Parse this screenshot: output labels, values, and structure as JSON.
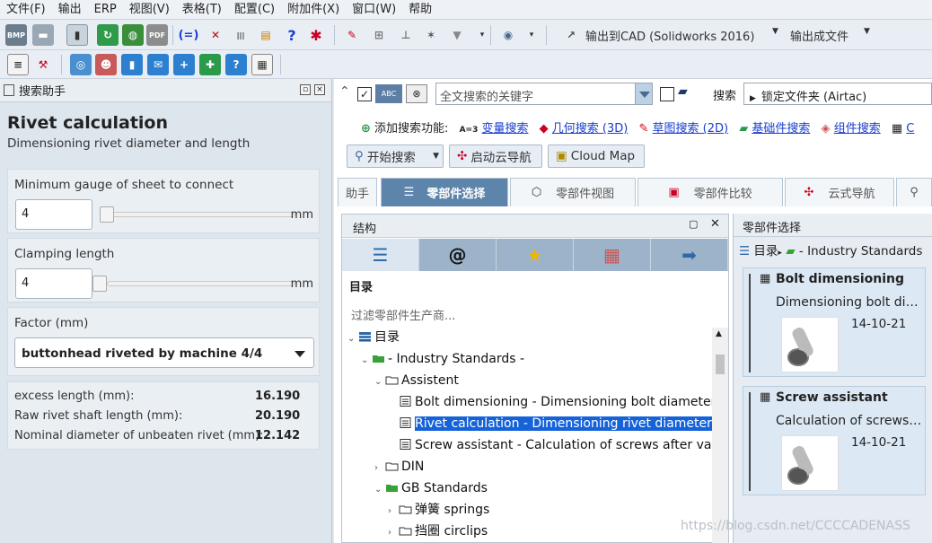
{
  "menu": [
    "文件(F)",
    "输出",
    "ERP",
    "视图(V)",
    "表格(T)",
    "配置(C)",
    "附加件(X)",
    "窗口(W)",
    "帮助"
  ],
  "toolbar": {
    "export_cad": "输出到CAD (Solidworks 2016)",
    "export_file": "输出成文件",
    "bmp_label": "BMP"
  },
  "left_panel": {
    "title": "搜索助手",
    "heading": "Rivet calculation",
    "subheading": "Dimensioning rivet diameter and length",
    "min_gauge": {
      "label": "Minimum gauge of sheet to connect",
      "value": "4",
      "unit": "mm"
    },
    "clamping": {
      "label": "Clamping length",
      "value": "4",
      "unit": "mm"
    },
    "factor": {
      "label": "Factor (mm)",
      "value": "buttonhead riveted by machine 4/4"
    },
    "results": [
      {
        "label": "excess length (mm):",
        "value": "16.190"
      },
      {
        "label": "Raw rivet shaft length (mm):",
        "value": "20.190"
      },
      {
        "label": "Nominal diameter of unbeaten rivet (mm):",
        "value": "12.142"
      }
    ]
  },
  "search": {
    "abc": "ABC",
    "placeholder": "全文搜索的关键字",
    "search_label": "搜索",
    "lock_folder": "锁定文件夹 (Airtac)"
  },
  "add_search": {
    "label": "添加搜索功能:",
    "var": "变量搜索",
    "geo": "几何搜索 (3D)",
    "sketch": "草图搜索 (2D)",
    "base": "基础件搜索",
    "assembly": "组件搜索",
    "more": "C"
  },
  "buttons": {
    "start": "开始搜索",
    "cloud_nav": "启动云导航",
    "cloud_map": "Cloud Map"
  },
  "tabs": [
    "助手",
    "零部件选择",
    "零部件视图",
    "零部件比较",
    "云式导航"
  ],
  "structure": {
    "title": "结构",
    "dir_label": "目录",
    "filter": "过滤零部件生产商...",
    "tree": [
      {
        "text": "目录",
        "level": 0,
        "tw": "v",
        "icon": "stack"
      },
      {
        "text": "- Industry Standards -",
        "level": 1,
        "tw": "v",
        "icon": "folder-green"
      },
      {
        "text": "Assistent",
        "level": 2,
        "tw": "v",
        "icon": "folder"
      },
      {
        "text": "Bolt dimensioning - Dimensioning bolt diameter",
        "level": 3,
        "tw": "",
        "icon": "calc"
      },
      {
        "text": "Rivet calculation - Dimensioning rivet diameter a",
        "level": 3,
        "tw": "",
        "icon": "calc",
        "selected": true
      },
      {
        "text": "Screw assistant - Calculation of screws after value",
        "level": 3,
        "tw": "",
        "icon": "calc"
      },
      {
        "text": "DIN",
        "level": 2,
        "tw": ">",
        "icon": "folder"
      },
      {
        "text": "GB Standards",
        "level": 2,
        "tw": "v",
        "icon": "folder-green"
      },
      {
        "text": "弹簧 springs",
        "level": 3,
        "tw": ">",
        "icon": "folder"
      },
      {
        "text": "挡圈 circlips",
        "level": 3,
        "tw": ">",
        "icon": "folder"
      }
    ]
  },
  "parts": {
    "title": "零部件选择",
    "path_dir": "目录",
    "path_std": "- Industry Standards",
    "cards": [
      {
        "title": "Bolt dimensioning",
        "desc": "Dimensioning bolt dia...",
        "date": "14-10-21"
      },
      {
        "title": "Screw assistant",
        "desc": "Calculation of screws ...",
        "date": "14-10-21"
      }
    ]
  },
  "watermark": "https://blog.csdn.net/CCCCADENASS"
}
